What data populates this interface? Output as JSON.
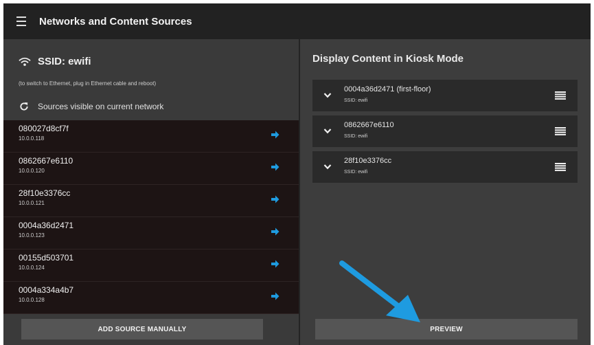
{
  "app_bar": {
    "title": "Networks and Content Sources",
    "menu_icon": "hamburger-menu-icon"
  },
  "network": {
    "ssid_label": "SSID: ewifi",
    "hint": "(to switch to Ethernet, plug in Ethernet cable and reboot)",
    "sources_label": "Sources visible on current network",
    "wifi_icon": "wifi-icon",
    "refresh_icon": "refresh-icon"
  },
  "sources": [
    {
      "id": "080027d8cf7f",
      "ip": "10.0.0.118"
    },
    {
      "id": "0862667e6110",
      "ip": "10.0.0.120"
    },
    {
      "id": "28f10e3376cc",
      "ip": "10.0.0.121"
    },
    {
      "id": "0004a36d2471",
      "ip": "10.0.0.123"
    },
    {
      "id": "00155d503701",
      "ip": "10.0.0.124"
    },
    {
      "id": "0004a334a4b7",
      "ip": "10.0.0.128"
    }
  ],
  "add_source_button": "ADD SOURCE MANUALLY",
  "kiosk": {
    "title": "Display Content in Kiosk Mode",
    "items": [
      {
        "name": "0004a36d2471  (first-floor)",
        "ssid": "SSID: ewifi"
      },
      {
        "name": "0862667e6110",
        "ssid": "SSID: ewifi"
      },
      {
        "name": "28f10e3376cc",
        "ssid": "SSID: ewifi"
      }
    ],
    "preview_button": "PREVIEW"
  },
  "colors": {
    "accent": "#1e9be0",
    "appbar": "#222222",
    "left_panel": "#3a3a3a",
    "source_list": "#1d1414",
    "right_panel": "#3d3d3d",
    "card": "#2a2a2a",
    "button": "#555555"
  }
}
